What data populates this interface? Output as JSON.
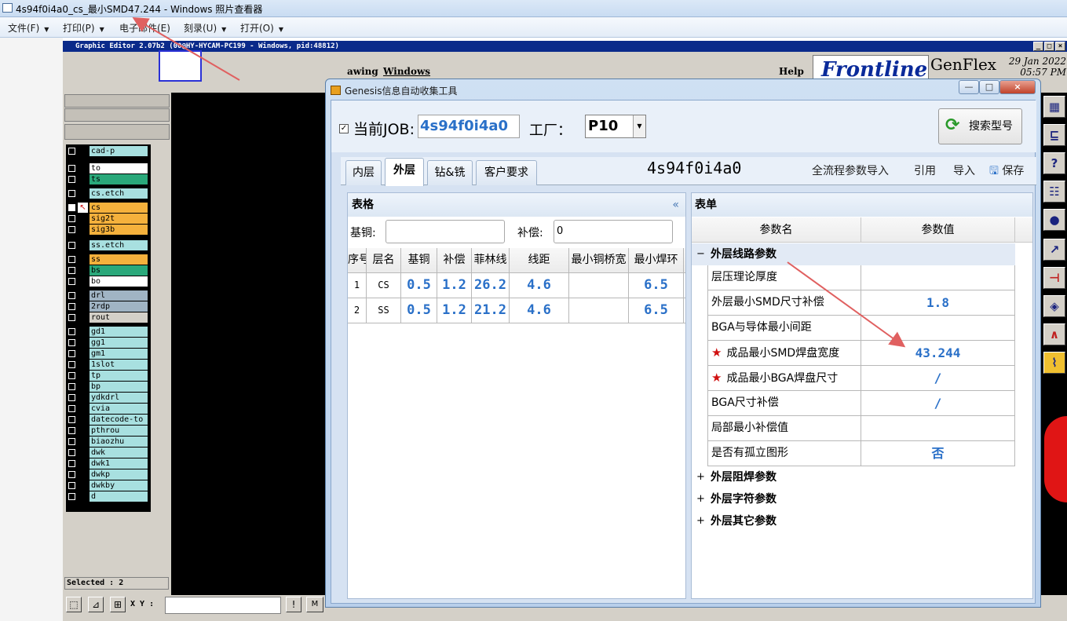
{
  "viewer": {
    "title": "4s94f0i4a0_cs_最小SMD47.244 - Windows 照片查看器",
    "menu": [
      {
        "label": "文件(F)"
      },
      {
        "label": "打印(P)"
      },
      {
        "label": "电子邮件(E)"
      },
      {
        "label": "刻录(U)"
      },
      {
        "label": "打开(O)"
      }
    ]
  },
  "editor": {
    "title": "Graphic Editor 2.07b2 (00@HY-HYCAM-PC199 - Windows, pid:48812)",
    "menu": {
      "drawing": "awing",
      "windows": "Windows",
      "help": "Help"
    },
    "logo": "Frontline",
    "product": "GenFlex",
    "date": "29 Jan 2022",
    "time": "05:57 PM",
    "selected": "Selected : 2",
    "xy_label": "X Y :",
    "status_char": "M"
  },
  "layers": [
    {
      "name": "cad-p",
      "color": "#a8e0e0"
    },
    {
      "name": "to",
      "color": "#ffffff"
    },
    {
      "name": "ts",
      "color": "#2aa87a"
    },
    {
      "name": "cs.etch",
      "color": "#a8e0e0"
    },
    {
      "name": "cs",
      "color": "#f5b13c"
    },
    {
      "name": "sig2t",
      "color": "#f5b13c"
    },
    {
      "name": "sig3b",
      "color": "#f5b13c"
    },
    {
      "name": "ss.etch",
      "color": "#a8e0e0"
    },
    {
      "name": "ss",
      "color": "#f5b13c"
    },
    {
      "name": "bs",
      "color": "#2aa87a"
    },
    {
      "name": "bo",
      "color": "#ffffff"
    },
    {
      "name": "drl",
      "color": "#a0b4c4"
    },
    {
      "name": "2rdp",
      "color": "#a0b4c4"
    },
    {
      "name": "rout",
      "color": "#d4d0c8"
    },
    {
      "name": "gd1",
      "color": "#a8e0e0"
    },
    {
      "name": "gg1",
      "color": "#a8e0e0"
    },
    {
      "name": "gm1",
      "color": "#a8e0e0"
    },
    {
      "name": "1slot",
      "color": "#a8e0e0"
    },
    {
      "name": "tp",
      "color": "#a8e0e0"
    },
    {
      "name": "bp",
      "color": "#a8e0e0"
    },
    {
      "name": "ydkdrl",
      "color": "#a8e0e0"
    },
    {
      "name": "cvia",
      "color": "#a8e0e0"
    },
    {
      "name": "datecode-to",
      "color": "#a8e0e0"
    },
    {
      "name": "pthrou",
      "color": "#a8e0e0"
    },
    {
      "name": "biaozhu",
      "color": "#a8e0e0"
    },
    {
      "name": "dwk",
      "color": "#a8e0e0"
    },
    {
      "name": "dwk1",
      "color": "#a8e0e0"
    },
    {
      "name": "dwkp",
      "color": "#a8e0e0"
    },
    {
      "name": "dwkby",
      "color": "#a8e0e0"
    },
    {
      "name": "d",
      "color": "#a8e0e0"
    }
  ],
  "dialog": {
    "title": "Genesis信息自动收集工具",
    "job_label": "当前JOB:",
    "job_value": "4s94f0i4a0",
    "factory_label": "工厂：",
    "factory_value": "P10",
    "search_button": "搜索型号",
    "tabs": [
      "内层",
      "外层",
      "钻&铣",
      "客户要求"
    ],
    "active_tab": "外层",
    "job_display": "4s94f0i4a0",
    "actions": {
      "import_all": "全流程参数导入",
      "reference": "引用",
      "import": "导入",
      "save": "保存"
    },
    "table": {
      "title": "表格",
      "collapse": "«",
      "base_copper_label": "基铜:",
      "base_copper_value": "",
      "comp_label": "补偿:",
      "comp_value": "0",
      "headers": [
        "序号",
        "层名",
        "基铜",
        "补偿",
        "菲林线",
        "线距",
        "最小铜桥宽",
        "最小焊环"
      ],
      "rows": [
        [
          "1",
          "CS",
          "0.5",
          "1.2",
          "26.2",
          "4.6",
          "",
          "6.5"
        ],
        [
          "2",
          "SS",
          "0.5",
          "1.2",
          "21.2",
          "4.6",
          "",
          "6.5"
        ]
      ]
    },
    "form": {
      "title": "表单",
      "col_name": "参数名",
      "col_value": "参数值",
      "group1": "外层线路参数",
      "group1_toggle": "−",
      "params": [
        {
          "name": "层压理论厚度",
          "value": "",
          "star": false
        },
        {
          "name": "外层最小SMD尺寸补偿",
          "value": "1.8",
          "star": false
        },
        {
          "name": "BGA与导体最小间距",
          "value": "",
          "star": false
        },
        {
          "name": "成品最小SMD焊盘宽度",
          "value": "43.244",
          "star": true
        },
        {
          "name": "成品最小BGA焊盘尺寸",
          "value": "/",
          "star": true
        },
        {
          "name": "BGA尺寸补偿",
          "value": "/",
          "star": false
        },
        {
          "name": "局部最小补偿值",
          "value": "",
          "star": false
        },
        {
          "name": "是否有孤立图形",
          "value": "否",
          "star": false
        }
      ],
      "groups_collapsed": [
        "外层阻焊参数",
        "外层字符参数",
        "外层其它参数"
      ],
      "collapsed_toggle": "+"
    }
  },
  "colors": {
    "accent_blue": "#2a70c8",
    "arrow": "#e06060",
    "star": "#d01010"
  }
}
